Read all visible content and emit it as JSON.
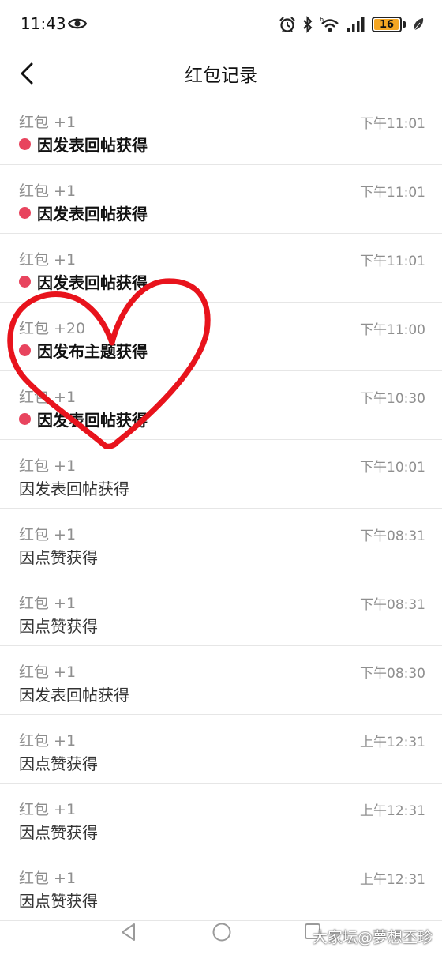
{
  "status_bar": {
    "time": "11:43",
    "battery_level": "16",
    "battery_percent": 16,
    "battery_color": "#f5a623",
    "icons": [
      "eye-icon",
      "alarm-icon",
      "bluetooth-icon",
      "wifi-6-icon",
      "signal-icon",
      "battery-icon",
      "leaf-icon"
    ]
  },
  "header": {
    "back_icon": "chevron-left-icon",
    "title": "红包记录"
  },
  "records": [
    {
      "amount": "红包 +1",
      "time": "下午11:01",
      "reason": "因发表回帖获得",
      "unread": true
    },
    {
      "amount": "红包 +1",
      "time": "下午11:01",
      "reason": "因发表回帖获得",
      "unread": true
    },
    {
      "amount": "红包 +1",
      "time": "下午11:01",
      "reason": "因发表回帖获得",
      "unread": true
    },
    {
      "amount": "红包 +20",
      "time": "下午11:00",
      "reason": "因发布主题获得",
      "unread": true
    },
    {
      "amount": "红包 +1",
      "time": "下午10:30",
      "reason": "因发表回帖获得",
      "unread": true
    },
    {
      "amount": "红包 +1",
      "time": "下午10:01",
      "reason": "因发表回帖获得",
      "unread": false
    },
    {
      "amount": "红包 +1",
      "time": "下午08:31",
      "reason": "因点赞获得",
      "unread": false
    },
    {
      "amount": "红包 +1",
      "time": "下午08:31",
      "reason": "因点赞获得",
      "unread": false
    },
    {
      "amount": "红包 +1",
      "time": "下午08:30",
      "reason": "因发表回帖获得",
      "unread": false
    },
    {
      "amount": "红包 +1",
      "time": "上午12:31",
      "reason": "因点赞获得",
      "unread": false
    },
    {
      "amount": "红包 +1",
      "time": "上午12:31",
      "reason": "因点赞获得",
      "unread": false
    },
    {
      "amount": "红包 +1",
      "time": "上午12:31",
      "reason": "因点赞获得",
      "unread": false
    }
  ],
  "colors": {
    "unread_dot": "#e8445e",
    "heart_doodle": "#e8131c"
  },
  "nav_bar": {
    "icons": [
      "nav-back-triangle-icon",
      "nav-home-circle-icon",
      "nav-recent-square-icon"
    ]
  },
  "watermark": "大家坛@夢想丕珍"
}
